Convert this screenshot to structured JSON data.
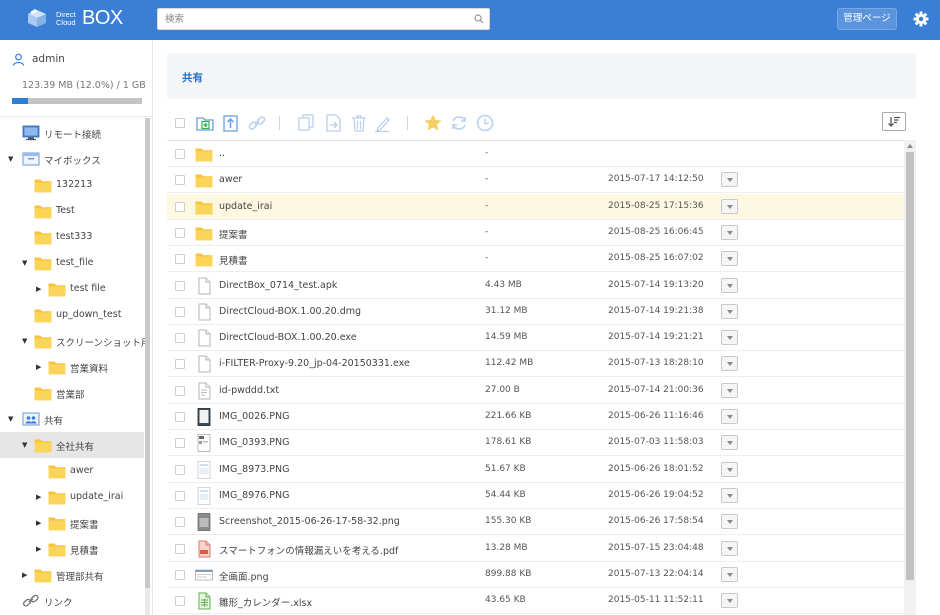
{
  "header": {
    "logo_small_line1": "Direct",
    "logo_small_line2": "Cloud",
    "logo_big": "BOX",
    "search_placeholder": "検索",
    "admin_button": "管理ページ",
    "brand_color": "#3a7fd5"
  },
  "sidebar": {
    "username": "admin",
    "usage_text": "123.39 MB (12.0%) / 1 GB",
    "usage_percent": 12.0,
    "tree": [
      {
        "label": "リモート接続",
        "icon": "remote-desktop-icon",
        "arrow": "",
        "depth": 0
      },
      {
        "label": "マイボックス",
        "icon": "mybox-icon",
        "arrow": "down",
        "depth": 0
      },
      {
        "label": "132213",
        "icon": "folder-icon",
        "arrow": "",
        "depth": 1
      },
      {
        "label": "Test",
        "icon": "folder-icon",
        "arrow": "",
        "depth": 1
      },
      {
        "label": "test333",
        "icon": "folder-icon",
        "arrow": "",
        "depth": 1
      },
      {
        "label": "test_file",
        "icon": "folder-icon",
        "arrow": "down",
        "depth": 1
      },
      {
        "label": "test file",
        "icon": "folder-icon",
        "arrow": "right",
        "depth": 2
      },
      {
        "label": "up_down_test",
        "icon": "folder-icon",
        "arrow": "",
        "depth": 1
      },
      {
        "label": "スクリーンショット用",
        "icon": "folder-icon",
        "arrow": "down",
        "depth": 1
      },
      {
        "label": "営業資料",
        "icon": "folder-icon",
        "arrow": "right",
        "depth": 2
      },
      {
        "label": "営業部",
        "icon": "folder-icon",
        "arrow": "",
        "depth": 1
      },
      {
        "label": "共有",
        "icon": "shared-icon",
        "arrow": "down",
        "depth": 0
      },
      {
        "label": "全社共有",
        "icon": "folder-icon",
        "arrow": "down",
        "depth": 1,
        "selected": true
      },
      {
        "label": "awer",
        "icon": "folder-icon",
        "arrow": "",
        "depth": 2
      },
      {
        "label": "update_irai",
        "icon": "folder-icon",
        "arrow": "right",
        "depth": 2
      },
      {
        "label": "提案書",
        "icon": "folder-icon",
        "arrow": "right",
        "depth": 2
      },
      {
        "label": "見積書",
        "icon": "folder-icon",
        "arrow": "right",
        "depth": 2
      },
      {
        "label": "管理部共有",
        "icon": "folder-icon",
        "arrow": "right",
        "depth": 1
      },
      {
        "label": "リンク",
        "icon": "link-icon",
        "arrow": "",
        "depth": 0
      }
    ]
  },
  "main": {
    "title": "共有",
    "files": [
      {
        "name": "..",
        "size": "-",
        "date": "",
        "icon": "folder-icon",
        "menu": false
      },
      {
        "name": "awer",
        "size": "-",
        "date": "2015-07-17 14:12:50",
        "icon": "folder-icon",
        "menu": true
      },
      {
        "name": "update_irai",
        "size": "-",
        "date": "2015-08-25 17:15:36",
        "icon": "folder-icon",
        "menu": true,
        "highlight": true
      },
      {
        "name": "提案書",
        "size": "-",
        "date": "2015-08-25 16:06:45",
        "icon": "folder-icon",
        "menu": true
      },
      {
        "name": "見積書",
        "size": "-",
        "date": "2015-08-25 16:07:02",
        "icon": "folder-icon",
        "menu": true
      },
      {
        "name": "DirectBox_0714_test.apk",
        "size": "4.43 MB",
        "date": "2015-07-14 19:13:20",
        "icon": "file-icon",
        "menu": true
      },
      {
        "name": "DirectCloud-BOX.1.00.20.dmg",
        "size": "31.12 MB",
        "date": "2015-07-14 19:21:38",
        "icon": "file-icon",
        "menu": true
      },
      {
        "name": "DirectCloud-BOX.1.00.20.exe",
        "size": "14.59 MB",
        "date": "2015-07-14 19:21:21",
        "icon": "file-icon",
        "menu": true
      },
      {
        "name": "i-FILTER-Proxy-9.20_jp-04-20150331.exe",
        "size": "112.42 MB",
        "date": "2015-07-13 18:28:10",
        "icon": "file-icon",
        "menu": true
      },
      {
        "name": "id-pwddd.txt",
        "size": "27.00 B",
        "date": "2015-07-14 21:00:36",
        "icon": "text-file-icon",
        "menu": true
      },
      {
        "name": "IMG_0026.PNG",
        "size": "221.66 KB",
        "date": "2015-06-26 11:16:46",
        "icon": "image-thumb-dark-icon",
        "menu": true
      },
      {
        "name": "IMG_0393.PNG",
        "size": "178.61 KB",
        "date": "2015-07-03 11:58:03",
        "icon": "image-thumb-icon",
        "menu": true
      },
      {
        "name": "IMG_8973.PNG",
        "size": "51.67 KB",
        "date": "2015-06-26 18:01:52",
        "icon": "image-thumb-light-icon",
        "menu": true
      },
      {
        "name": "IMG_8976.PNG",
        "size": "54.44 KB",
        "date": "2015-06-26 19:04:52",
        "icon": "image-thumb-light-icon",
        "menu": true
      },
      {
        "name": "Screenshot_2015-06-26-17-58-32.png",
        "size": "155.30 KB",
        "date": "2015-06-26 17:58:54",
        "icon": "image-thumb-gray-icon",
        "menu": true
      },
      {
        "name": "スマートフォンの情報漏えいを考える.pdf",
        "size": "13.28 MB",
        "date": "2015-07-15 23:04:48",
        "icon": "pdf-icon",
        "menu": true
      },
      {
        "name": "全画面.png",
        "size": "899.88 KB",
        "date": "2015-07-13 22:04:14",
        "icon": "image-thumb-wide-icon",
        "menu": true
      },
      {
        "name": "雛形_カレンダー.xlsx",
        "size": "43.65 KB",
        "date": "2015-05-11 11:52:11",
        "icon": "excel-icon",
        "menu": true
      }
    ]
  }
}
